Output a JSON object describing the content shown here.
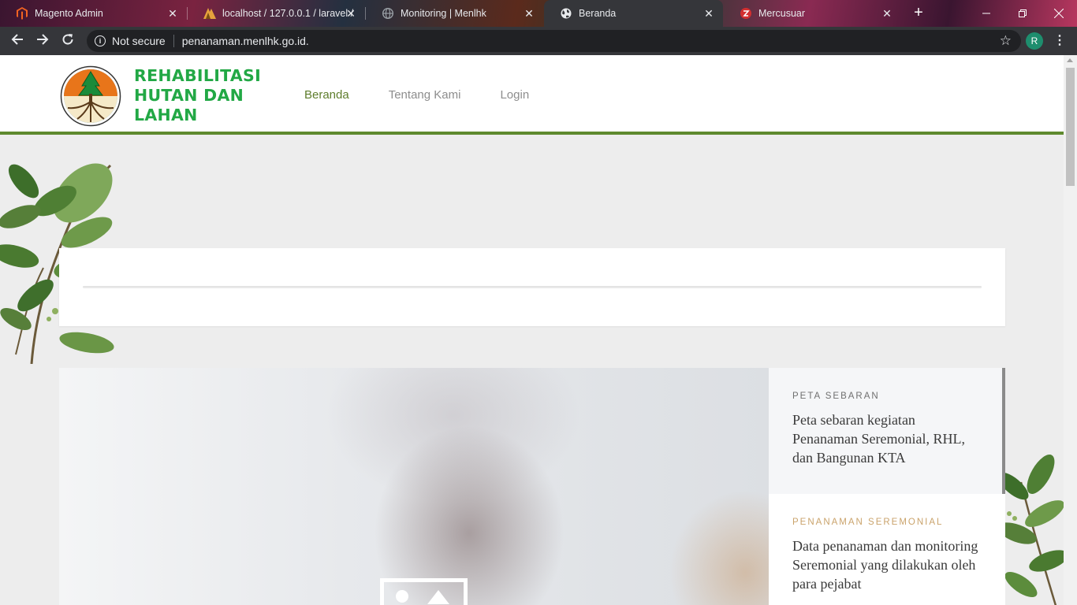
{
  "browser": {
    "tabs": [
      {
        "label": "Magento Admin",
        "icon": "magento-icon"
      },
      {
        "label": "localhost / 127.0.0.1 / laravel /",
        "icon": "phpmyadmin-icon"
      },
      {
        "label": "Monitoring | Menlhk",
        "icon": "globe-icon"
      },
      {
        "label": "Beranda",
        "icon": "globe-icon",
        "active": true
      },
      {
        "label": "Mercusuar",
        "icon": "mercusuar-icon"
      }
    ],
    "security_label": "Not secure",
    "url": "penanaman.menlhk.go.id.",
    "profile_initial": "R"
  },
  "site": {
    "brand": {
      "line1": "REHABILITASI",
      "line2": "HUTAN DAN",
      "line3": "LAHAN"
    },
    "nav": [
      {
        "label": "Beranda",
        "active": true
      },
      {
        "label": "Tentang Kami",
        "active": false
      },
      {
        "label": "Login",
        "active": false
      }
    ],
    "features": [
      {
        "kicker": "PETA SEBARAN",
        "description": "Peta sebaran kegiatan Penanaman Seremonial, RHL, dan Bangunan KTA"
      },
      {
        "kicker": "PENANAMAN SEREMONIAL",
        "description": "Data penanaman dan monitoring Seremonial yang dilakukan oleh para pejabat"
      }
    ]
  },
  "colors": {
    "brand_green": "#22a845",
    "header_border": "#5e8a2e",
    "nav_active": "#5e7d2c",
    "accent_kicker": "#caa36b"
  }
}
